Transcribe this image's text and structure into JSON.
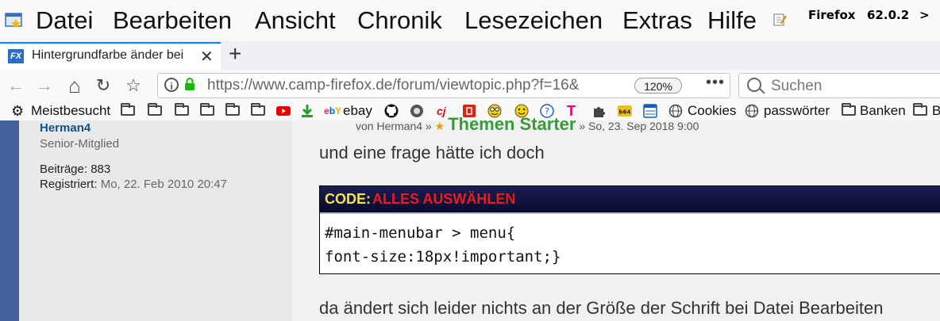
{
  "menubar": {
    "items": [
      "Datei",
      "Bearbeiten",
      "Ansicht",
      "Chronik",
      "Lesezeichen",
      "Extras",
      "Hilfe"
    ],
    "browser_name": "Firefox",
    "version": "62.0.2",
    "overflow": ">"
  },
  "tab": {
    "title": "Hintergrundfarbe änder bei",
    "favicon_text": "FX",
    "close": "✕",
    "new_tab": "+"
  },
  "navbar": {
    "back": "←",
    "forward": "→",
    "home": "⌂",
    "reload": "↻",
    "bookmark": "☆",
    "url_host": "https://www.camp-firefox.de",
    "url_path": "/forum/viewtopic.php?f=16&",
    "zoom": "120%",
    "page_actions": "•••",
    "search_placeholder": "Suchen"
  },
  "bookmarks": {
    "most_visited": "Meistbesucht",
    "ebay": "ebay",
    "cookies": "Cookies",
    "passwords": "passwörter",
    "banks": "Banken",
    "next": "B"
  },
  "post": {
    "author": "Herman4",
    "rank": "Senior-Mitglied",
    "posts_label": "Beiträge:",
    "posts_value": "883",
    "registered_label": "Registriert:",
    "registered_value": "Mo, 22. Feb 2010 20:47",
    "header_text": "von Herman4 »",
    "header_starter": "Themen Starter",
    "header_date": "» So, 23. Sep 2018 9:00",
    "line1": "und eine frage hätte ich doch",
    "code_label": "CODE:",
    "code_select": "ALLES AUSWÄHLEN",
    "code_lines": [
      "#main-menubar > menu{",
      "font-size:18px!important;}"
    ],
    "line2": "da ändert sich leider nichts an der Größe der Schrift bei Datei Bearbeiten"
  },
  "colors": {
    "accent": "#0a84ff",
    "forum_blue": "#45619c",
    "code_label": "#f7e24b",
    "code_select": "#ee1b1b"
  }
}
